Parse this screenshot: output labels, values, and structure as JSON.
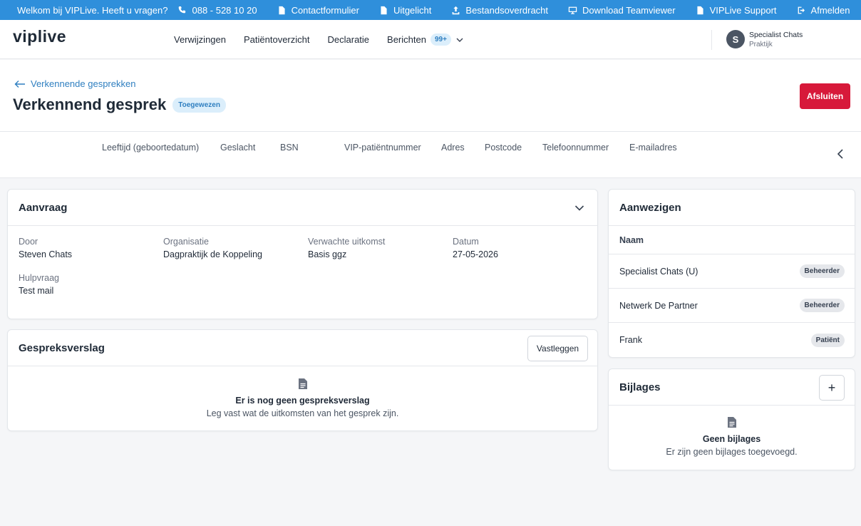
{
  "topbar": {
    "welcome": "Welkom bij VIPLive. Heeft u vragen?",
    "phone": "088 - 528 10 20",
    "contact": "Contactformulier",
    "highlight": "Uitgelicht",
    "transfer": "Bestandsoverdracht",
    "teamviewer": "Download Teamviewer",
    "support": "VIPLive Support",
    "logout": "Afmelden"
  },
  "nav": {
    "logo": "viplive",
    "items": [
      "Verwijzingen",
      "Patiëntoverzicht",
      "Declaratie",
      "Berichten"
    ],
    "message_count": "99+",
    "user": {
      "initial": "S",
      "name": "Specialist Chats",
      "role": "Praktijk"
    }
  },
  "header": {
    "back_label": "Verkennende gesprekken",
    "title": "Verkennend gesprek",
    "status": "Toegewezen",
    "close_label": "Afsluiten"
  },
  "patient_fields": [
    "Leeftijd (geboortedatum)",
    "Geslacht",
    "BSN",
    "VIP-patiëntnummer",
    "Adres",
    "Postcode",
    "Telefoonnummer",
    "E-mailadres"
  ],
  "request": {
    "title": "Aanvraag",
    "fields": [
      {
        "label": "Door",
        "value": "Steven Chats"
      },
      {
        "label": "Organisatie",
        "value": "Dagpraktijk de Koppeling"
      },
      {
        "label": "Verwachte uitkomst",
        "value": "Basis ggz"
      },
      {
        "label": "Datum",
        "value": "27-05-2026"
      },
      {
        "label": "Hulpvraag",
        "value": "Test mail"
      }
    ]
  },
  "report": {
    "title": "Gespreksverslag",
    "save_label": "Vastleggen",
    "empty_title": "Er is nog geen gespreksverslag",
    "empty_sub": "Leg vast wat de uitkomsten van het gesprek zijn."
  },
  "attendees": {
    "title": "Aanwezigen",
    "column": "Naam",
    "rows": [
      {
        "name": "Specialist Chats (U)",
        "role": "Beheerder"
      },
      {
        "name": "Netwerk De Partner",
        "role": "Beheerder"
      },
      {
        "name": "Frank",
        "role": "Patiënt"
      }
    ]
  },
  "attachments": {
    "title": "Bijlages",
    "add_label": "+",
    "empty_title": "Geen bijlages",
    "empty_sub": "Er zijn geen bijlages toegevoegd."
  },
  "colors": {
    "primary": "#2f8fdb",
    "danger": "#d7193a",
    "badge_bg": "#dbeefb"
  }
}
